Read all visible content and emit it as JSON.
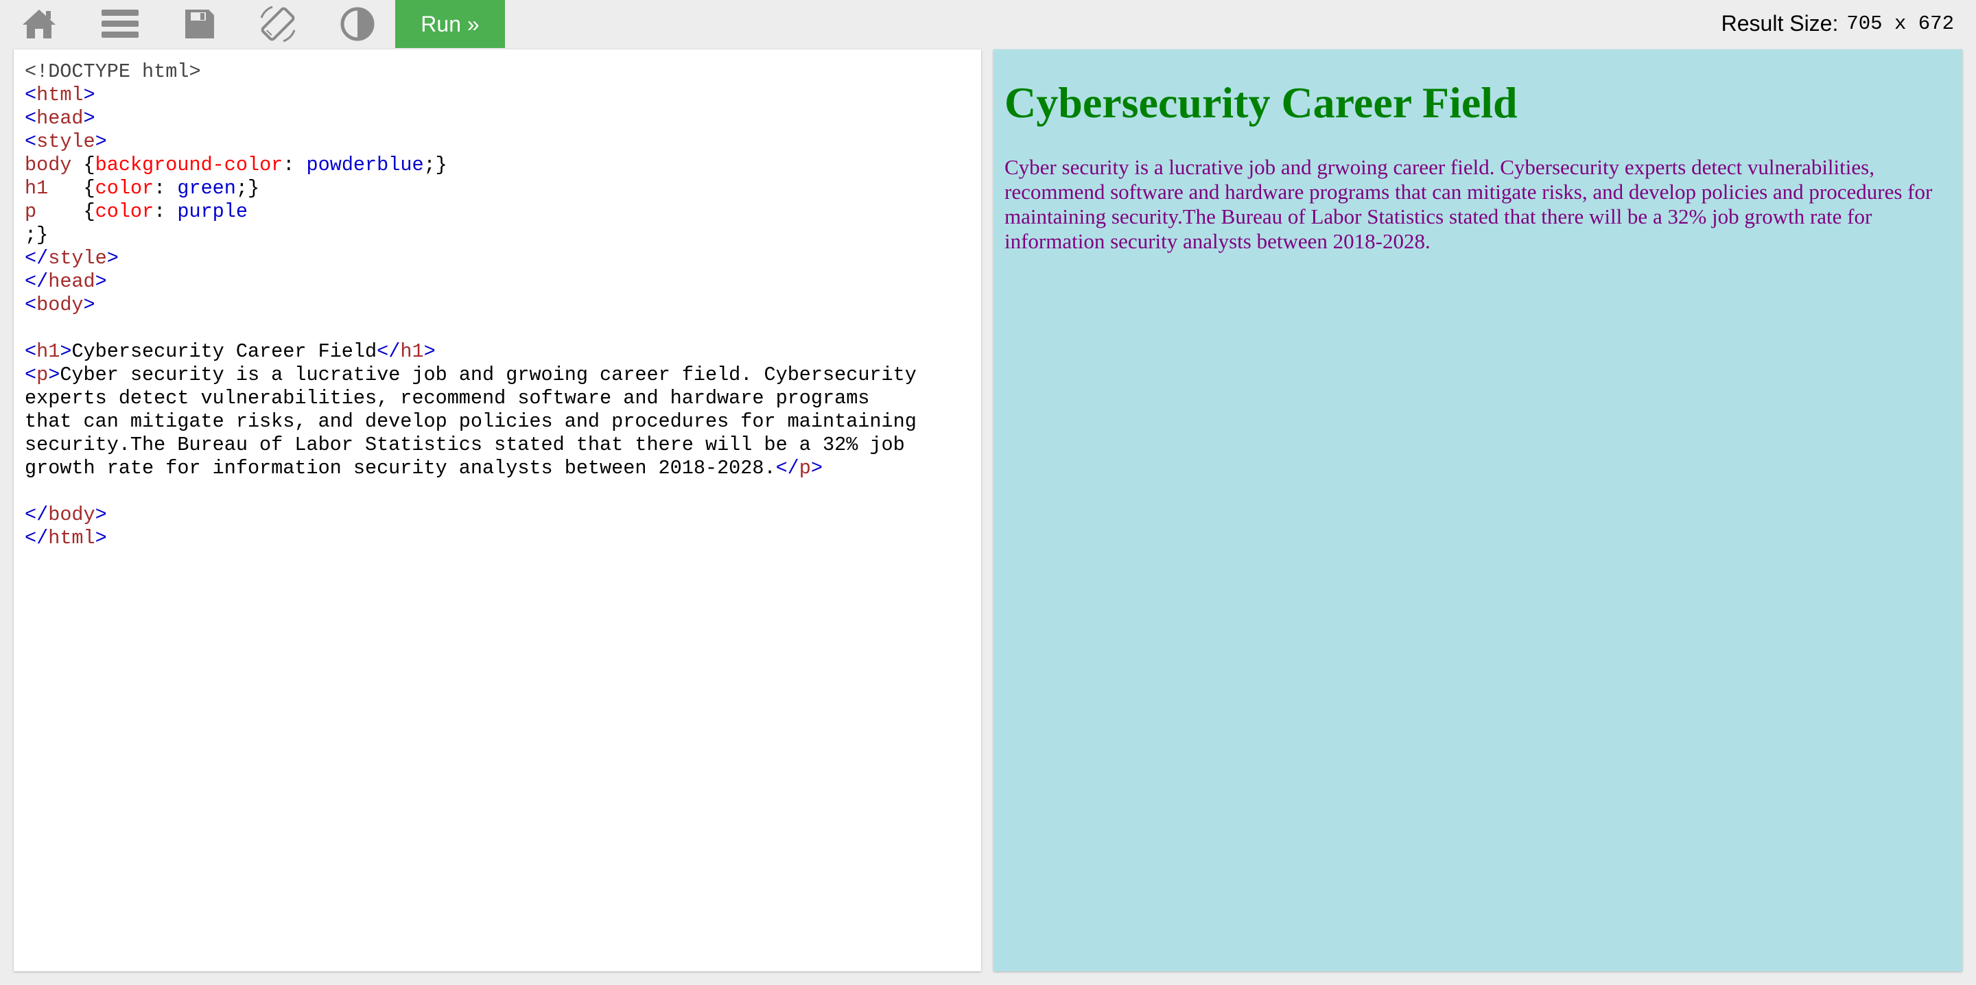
{
  "toolbar": {
    "icons": [
      "home-icon",
      "menu-icon",
      "save-icon",
      "rotate-icon",
      "contrast-icon"
    ],
    "run_label": "Run »",
    "result_size_label": "Result Size:",
    "result_size_value": "705 x 672"
  },
  "editor": {
    "lines": [
      [
        {
          "c": "t-doctype",
          "t": "<!DOCTYPE html>"
        }
      ],
      [
        {
          "c": "t-br",
          "t": "<"
        },
        {
          "c": "t-tag",
          "t": "html"
        },
        {
          "c": "t-br",
          "t": ">"
        }
      ],
      [
        {
          "c": "t-br",
          "t": "<"
        },
        {
          "c": "t-tag",
          "t": "head"
        },
        {
          "c": "t-br",
          "t": ">"
        }
      ],
      [
        {
          "c": "t-br",
          "t": "<"
        },
        {
          "c": "t-tag",
          "t": "style"
        },
        {
          "c": "t-br",
          "t": ">"
        }
      ],
      [
        {
          "c": "t-tag",
          "t": "body"
        },
        {
          "c": "t-plain",
          "t": " {"
        },
        {
          "c": "t-prop",
          "t": "background-color"
        },
        {
          "c": "t-plain",
          "t": ": "
        },
        {
          "c": "t-val",
          "t": "powderblue"
        },
        {
          "c": "t-plain",
          "t": ";}"
        }
      ],
      [
        {
          "c": "t-tag",
          "t": "h1"
        },
        {
          "c": "t-plain",
          "t": "   {"
        },
        {
          "c": "t-prop",
          "t": "color"
        },
        {
          "c": "t-plain",
          "t": ": "
        },
        {
          "c": "t-val",
          "t": "green"
        },
        {
          "c": "t-plain",
          "t": ";}"
        }
      ],
      [
        {
          "c": "t-tag",
          "t": "p"
        },
        {
          "c": "t-plain",
          "t": "    {"
        },
        {
          "c": "t-prop",
          "t": "color"
        },
        {
          "c": "t-plain",
          "t": ": "
        },
        {
          "c": "t-val",
          "t": "purple"
        }
      ],
      [
        {
          "c": "t-plain",
          "t": ";}"
        }
      ],
      [
        {
          "c": "t-br",
          "t": "</"
        },
        {
          "c": "t-tag",
          "t": "style"
        },
        {
          "c": "t-br",
          "t": ">"
        }
      ],
      [
        {
          "c": "t-br",
          "t": "</"
        },
        {
          "c": "t-tag",
          "t": "head"
        },
        {
          "c": "t-br",
          "t": ">"
        }
      ],
      [
        {
          "c": "t-br",
          "t": "<"
        },
        {
          "c": "t-tag",
          "t": "body"
        },
        {
          "c": "t-br",
          "t": ">"
        }
      ],
      [],
      [
        {
          "c": "t-br",
          "t": "<"
        },
        {
          "c": "t-tag",
          "t": "h1"
        },
        {
          "c": "t-br",
          "t": ">"
        },
        {
          "c": "t-plain",
          "t": "Cybersecurity Career Field"
        },
        {
          "c": "t-br",
          "t": "</"
        },
        {
          "c": "t-tag",
          "t": "h1"
        },
        {
          "c": "t-br",
          "t": ">"
        }
      ],
      [
        {
          "c": "t-br",
          "t": "<"
        },
        {
          "c": "t-tag",
          "t": "p"
        },
        {
          "c": "t-br",
          "t": ">"
        },
        {
          "c": "t-plain",
          "t": "Cyber security is a lucrative job and grwoing career field. Cybersecurity"
        }
      ],
      [
        {
          "c": "t-plain",
          "t": "experts detect vulnerabilities, recommend software and hardware programs"
        }
      ],
      [
        {
          "c": "t-plain",
          "t": "that can mitigate risks, and develop policies and procedures for maintaining"
        }
      ],
      [
        {
          "c": "t-plain",
          "t": "security.The Bureau of Labor Statistics stated that there will be a 32% job"
        }
      ],
      [
        {
          "c": "t-plain",
          "t": "growth rate for information security analysts between 2018-2028."
        },
        {
          "c": "t-br",
          "t": "</"
        },
        {
          "c": "t-tag",
          "t": "p"
        },
        {
          "c": "t-br",
          "t": ">"
        }
      ],
      [],
      [
        {
          "c": "t-br",
          "t": "</"
        },
        {
          "c": "t-tag",
          "t": "body"
        },
        {
          "c": "t-br",
          "t": ">"
        }
      ],
      [
        {
          "c": "t-br",
          "t": "</"
        },
        {
          "c": "t-tag",
          "t": "html"
        },
        {
          "c": "t-br",
          "t": ">"
        }
      ]
    ]
  },
  "result": {
    "heading": "Cybersecurity Career Field",
    "paragraph": "Cyber security is a lucrative job and grwoing career field. Cybersecurity experts detect vulnerabilities, recommend software and hardware programs that can mitigate risks, and develop policies and procedures for maintaining security.The Bureau of Labor Statistics stated that there will be a 32% job growth rate for information security analysts between 2018-2028."
  },
  "colors": {
    "run_button": "#4caf50",
    "result_background": "#b0e0e6",
    "heading_color": "#008000",
    "paragraph_color": "#800080"
  }
}
